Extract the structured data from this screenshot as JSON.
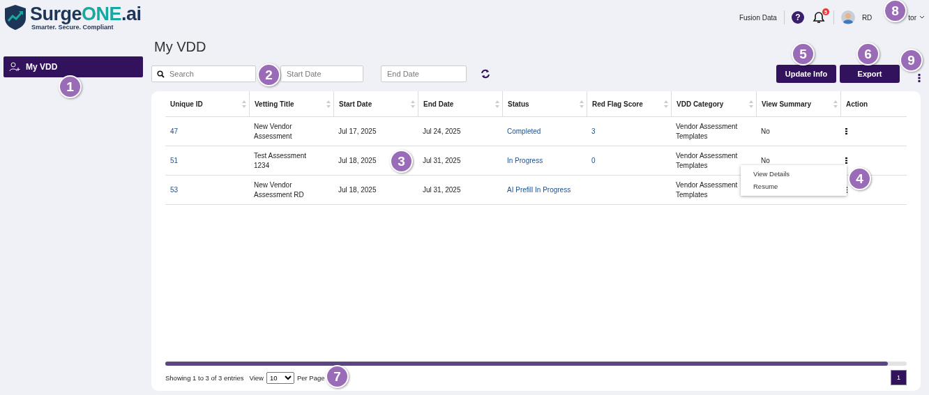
{
  "brand": {
    "name_main": "Surge",
    "name_accent": "ONE",
    "name_suffix": ".ai",
    "tagline": "Smarter. Secure. Compliant"
  },
  "header": {
    "org": "Fusion Data",
    "help": "?",
    "notifications": "5",
    "user_left": "RD",
    "user_right": "tor"
  },
  "sidebar": {
    "items": [
      {
        "label": "My VDD",
        "selected": true
      }
    ]
  },
  "page_title": "My VDD",
  "filters": {
    "search_placeholder": "Search",
    "start_placeholder": "Start Date",
    "end_placeholder": "End Date"
  },
  "buttons": [
    "Update Info",
    "Export"
  ],
  "table": {
    "columns": [
      {
        "label": "Unique ID",
        "sortable": true
      },
      {
        "label": "Vetting Title",
        "sortable": true
      },
      {
        "label": "Start Date",
        "sortable": true
      },
      {
        "label": "End Date",
        "sortable": true
      },
      {
        "label": "Status",
        "sortable": true
      },
      {
        "label": "Red Flag Score",
        "sortable": true
      },
      {
        "label": "VDD Category",
        "sortable": true
      },
      {
        "label": "View Summary",
        "sortable": true
      },
      {
        "label": "Action",
        "sortable": false
      }
    ],
    "rows": [
      {
        "cells": [
          "47",
          "New Vendor Assessment",
          "Jul 17, 2025",
          "Jul 24, 2025",
          "Completed",
          "3",
          "Vendor Assessment Templates",
          "No"
        ]
      },
      {
        "cells": [
          "51",
          "Test Assessment 1234",
          "Jul 18, 2025",
          "Jul 31, 2025",
          "In Progress",
          "0",
          "Vendor Assessment Templates",
          "No"
        ],
        "menu": [
          "View Details",
          "Resume"
        ]
      },
      {
        "cells": [
          "53",
          "New Vendor Assessment RD",
          "Jul 18, 2025",
          "Jul 31, 2025",
          "AI Prefill In Progress",
          "",
          "Vendor Assessment Templates",
          ""
        ]
      }
    ]
  },
  "footer": {
    "showing": "Showing 1 to 3 of 3 entries",
    "view": "View",
    "per_page_value": "10",
    "per_page": "Per Page",
    "pages": [
      {
        "label": "1",
        "selected": true
      }
    ]
  },
  "callouts": [
    "1",
    "2",
    "3",
    "4",
    "5",
    "6",
    "7",
    "8",
    "9"
  ]
}
